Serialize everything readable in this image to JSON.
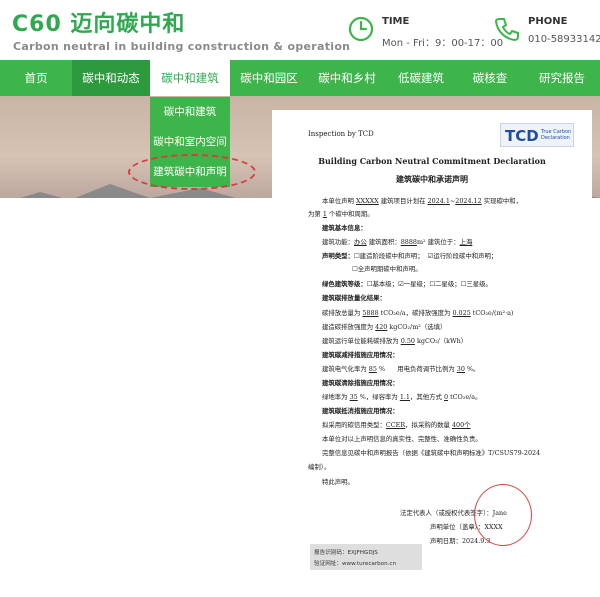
{
  "header": {
    "logo_title": "C60 迈向碳中和",
    "logo_subtitle": "Carbon neutral in building construction & operation",
    "time_label": "TIME",
    "time_value": "Mon - Fri：9：00-17：00",
    "phone_label": "PHONE",
    "phone_value": "010-58933142",
    "accent_color": "#3db54a"
  },
  "nav": {
    "items": [
      "首页",
      "碳中和动态",
      "碳中和建筑",
      "碳中和园区",
      "碳中和乡村",
      "低碳建筑",
      "碳核查",
      "研究报告"
    ]
  },
  "dropdown": {
    "items": [
      "碳中和建筑",
      "碳中和室内空间",
      "建筑碳中和声明"
    ]
  },
  "doc": {
    "inspection": "Inspection by TCD",
    "logo_big": "TCD",
    "logo_small_1": "True Carbon",
    "logo_small_2": "Declaration",
    "title_en": "Building Carbon Neutral Commitment Declaration",
    "title_cn": "建筑碳中和承诺声明",
    "p1a": "本单位声明 ",
    "p1_name": "XXXXX",
    "p1b": " 建筑项目计划在 ",
    "p1_from": "2024.1",
    "p1_to": "2024.12",
    "p1c": " 实现碳中和，",
    "p2a": "为第 ",
    "p2_n": "1",
    "p2b": " 个碳中和周期。",
    "basic_title": "建筑基本信息：",
    "b1a": "建筑功能：",
    "b1_func": "办公",
    "b1b": " 建筑面积：",
    "b1_area": "8888",
    "b1c": "m² 建筑位于：",
    "b1_loc": "上海",
    "decl_label": "声明类型：",
    "decl_opt1": "☐建造阶段碳中和声明；",
    "decl_opt2": "☑运行阶段碳中和声明；",
    "decl_opt3": "☐全声明期碳中和声明。",
    "green_label": "绿色建筑等级：",
    "green_opts": "☐基本级；☑一星级；☐二星级；☐三星级。",
    "emission_title": "建筑碳排放量化结果：",
    "e1a": "碳排放总量为 ",
    "e1_total": "5888",
    "e1b": " tCO₂e/a，碳排放强度为 ",
    "e1_int": "0.025",
    "e1c": " tCO₂e/(m²·a)",
    "e2a": "建造碳排放强度为 ",
    "e2_val": "420",
    "e2b": " kgCO₂/m²（选填）",
    "e3a": "建筑运行单位能耗碳排放为 ",
    "e3_val": "0.50",
    "e3b": " kgCO₂/（kWh）",
    "reduce_title": "建筑碳减排措施应用情况：",
    "r1a": "建筑电气化率为 ",
    "r1_val": "85",
    "r1b": " %",
    "r1c": "用电负荷调节比例为 ",
    "r1_val2": "30",
    "r1d": " %。",
    "remove_title": "建筑碳清除措施应用情况：",
    "m1a": "绿地率为 ",
    "m1_val": "35",
    "m1b": " %，绿容率为 ",
    "m1_val2": "1.1",
    "m1c": "，其他方式 ",
    "m1_val3": "0",
    "m1d": " tCO₂e/a。",
    "offset_title": "建筑碳抵消措施应用情况：",
    "o1a": "拟采用的碳信用类型：",
    "o1_type": "CCER",
    "o1b": "，拟采购的数量 ",
    "o1_num": "400个",
    "o2": "本单位对以上声明信息的真实性、完整性、准确性负责。",
    "o3": "完整信息见碳中和声明报告（依据《建筑碳中和声明标准》T/CSUS79-2024",
    "o4": "编制）。",
    "o5": "特此声明。",
    "sig1a": "法定代表人（或授权代表签字）：",
    "sig1_name": "Jane",
    "sig2a": "声明单位（盖章）：",
    "sig2_name": "XXXX",
    "sig3a": "声明日期：",
    "sig3_date": "2024.9.3"
  },
  "footbox": {
    "code_label": "报告识别码：",
    "code_value": "EXJFHGDJS",
    "site_label": "验证网址：",
    "site_value": "www.turecarbon.cn"
  }
}
